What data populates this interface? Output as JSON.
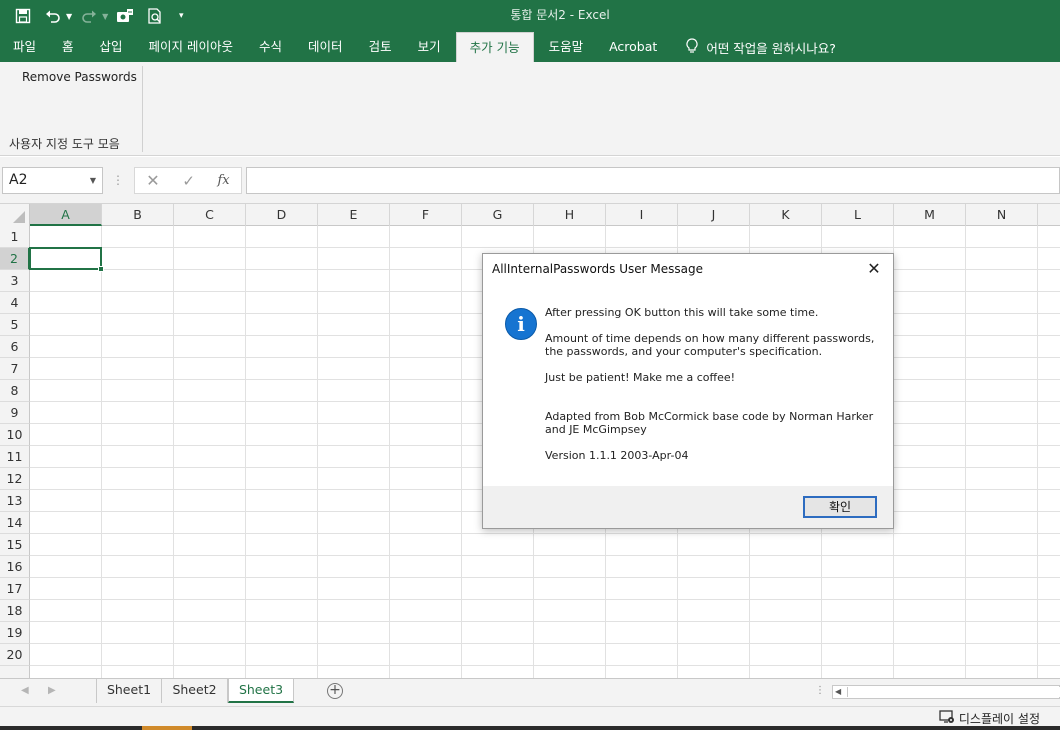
{
  "window": {
    "title": "통합 문서2  -  Excel"
  },
  "colors": {
    "accent": "#217346",
    "dialog_info": "#1674d1",
    "ok_border": "#2d6cc0"
  },
  "quick_access": [
    {
      "name": "save-icon"
    },
    {
      "name": "undo-icon"
    },
    {
      "name": "redo-icon"
    },
    {
      "name": "touch-mode-icon"
    },
    {
      "name": "print-preview-icon"
    },
    {
      "name": "customize-qat-icon"
    }
  ],
  "ribbon": {
    "tabs": [
      "파일",
      "홈",
      "삽입",
      "페이지 레이아웃",
      "수식",
      "데이터",
      "검토",
      "보기",
      "추가 기능",
      "도움말",
      "Acrobat"
    ],
    "active_tab": "추가 기능",
    "tell_me": "어떤 작업을 원하시나요?",
    "group_button": "Remove Passwords",
    "group_label": "사용자 지정 도구 모음"
  },
  "formula_bar": {
    "name_box": "A2",
    "fx_label": "fx",
    "formula": ""
  },
  "grid": {
    "columns": [
      "A",
      "B",
      "C",
      "D",
      "E",
      "F",
      "G",
      "H",
      "I",
      "J",
      "K",
      "L",
      "M",
      "N"
    ],
    "rows": [
      "1",
      "2",
      "3",
      "4",
      "5",
      "6",
      "7",
      "8",
      "9",
      "10",
      "11",
      "12",
      "13",
      "14",
      "15",
      "16",
      "17",
      "18",
      "19",
      "20"
    ],
    "selected_column": "A",
    "selected_row": "2"
  },
  "sheets": {
    "tabs": [
      "Sheet1",
      "Sheet2",
      "Sheet3"
    ],
    "active": "Sheet3"
  },
  "status_bar": {
    "display_settings": "디스플레이 설정"
  },
  "dialog": {
    "title": "AllInternalPasswords User Message",
    "lines": [
      "After pressing OK button this will take some time.",
      "Amount of time depends on how many different passwords, the passwords, and your computer's specification.",
      "Just be patient! Make me a coffee!",
      "Adapted from Bob McCormick base code by Norman Harker and JE McGimpsey",
      "Version 1.1.1 2003-Apr-04"
    ],
    "ok_label": "확인"
  }
}
